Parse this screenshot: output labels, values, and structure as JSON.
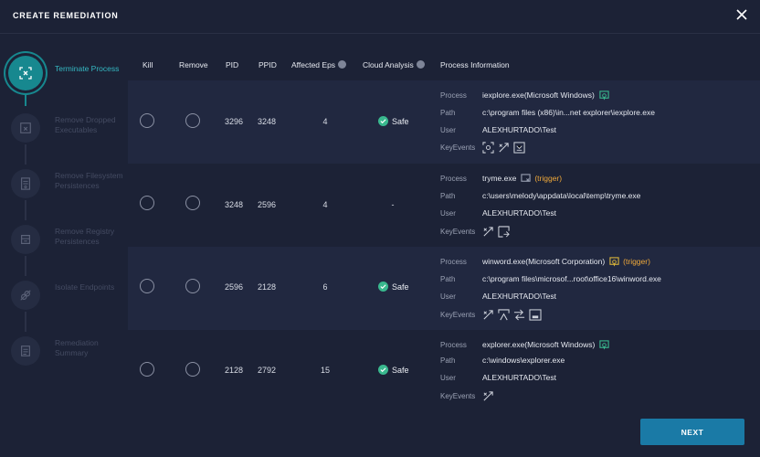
{
  "dialog": {
    "title": "CREATE REMEDIATION"
  },
  "steps": [
    {
      "label": "Terminate Process",
      "icon": "terminate-process-icon",
      "active": true
    },
    {
      "label": "Remove Dropped Executables",
      "icon": "remove-executables-icon",
      "active": false
    },
    {
      "label": "Remove Filesystem Persistences",
      "icon": "filesystem-icon",
      "active": false
    },
    {
      "label": "Remove Registry Persistences",
      "icon": "registry-icon",
      "active": false
    },
    {
      "label": "Isolate Endpoints",
      "icon": "isolate-icon",
      "active": false
    },
    {
      "label": "Remediation Summary",
      "icon": "summary-icon",
      "active": false
    }
  ],
  "table": {
    "headers": {
      "kill": "Kill",
      "remove": "Remove",
      "pid": "PID",
      "ppid": "PPID",
      "affected": "Affected Eps",
      "cloud": "Cloud Analysis",
      "process_info": "Process Information"
    },
    "info_labels": {
      "process": "Process",
      "path": "Path",
      "user": "User",
      "keyevents": "KeyEvents"
    },
    "rows": [
      {
        "pid": "3296",
        "ppid": "3248",
        "affected": "4",
        "cloud": "Safe",
        "cloud_state": "safe",
        "process": "iexplore.exe(Microsoft Windows)",
        "process_icon_color": "#39b88e",
        "trigger": "",
        "path": "c:\\program files (x86)\\in...net explorer\\iexplore.exe",
        "user": "ALEXHURTADO\\Test",
        "keyevents": [
          "network-event-icon",
          "injection-event-icon",
          "file-event-icon"
        ]
      },
      {
        "pid": "3248",
        "ppid": "2596",
        "affected": "4",
        "cloud": "-",
        "cloud_state": "none",
        "process": "tryme.exe",
        "process_icon_color": "#9aa1b3",
        "trigger": "(trigger)",
        "path": "c:\\users\\melody\\appdata\\local\\temp\\tryme.exe",
        "user": "ALEXHURTADO\\Test",
        "keyevents": [
          "injection-event-icon",
          "execution-event-icon"
        ]
      },
      {
        "pid": "2596",
        "ppid": "2128",
        "affected": "6",
        "cloud": "Safe",
        "cloud_state": "safe",
        "process": "winword.exe(Microsoft Corporation)",
        "process_icon_color": "#d9b43a",
        "trigger": "(trigger)",
        "path": "c:\\program files\\microsof...root\\office16\\winword.exe",
        "user": "ALEXHURTADO\\Test",
        "keyevents": [
          "injection-event-icon",
          "macro-event-icon",
          "transfer-event-icon",
          "terminal-event-icon"
        ]
      },
      {
        "pid": "2128",
        "ppid": "2792",
        "affected": "15",
        "cloud": "Safe",
        "cloud_state": "safe",
        "process": "explorer.exe(Microsoft Windows)",
        "process_icon_color": "#39b88e",
        "trigger": "",
        "path": "c:\\windows\\explorer.exe",
        "user": "ALEXHURTADO\\Test",
        "keyevents": [
          "injection-event-icon"
        ]
      }
    ]
  },
  "footer": {
    "next_label": "NEXT"
  },
  "colors": {
    "accent": "#17888f",
    "button": "#1a7aa6",
    "safe": "#39b88e",
    "trigger": "#f0a93a",
    "background": "#1c2236"
  }
}
